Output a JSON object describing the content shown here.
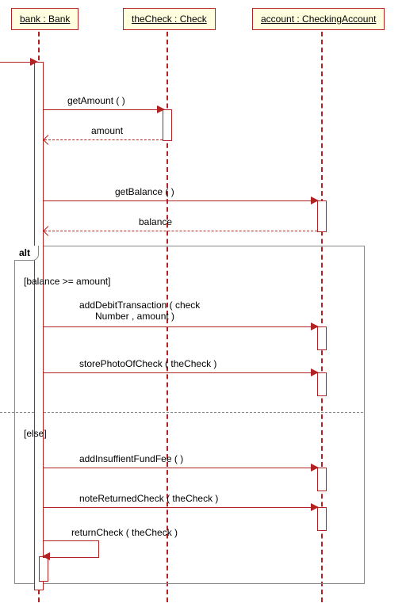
{
  "participants": {
    "bank": "bank : Bank",
    "check": "theCheck : Check",
    "account": "account : CheckingAccount"
  },
  "messages": {
    "getAmount": "getAmount ( )",
    "amount": "amount",
    "getBalance": "getBalance ( )",
    "balance": "balance",
    "addDebit": "addDebitTransaction ( check",
    "addDebit2": "Number , amount )",
    "storePhoto": "storePhotoOfCheck ( theCheck )",
    "addFee": "addInsuffientFundFee ( )",
    "noteReturned": "noteReturnedCheck ( theCheck )",
    "returnCheck": "returnCheck ( theCheck )"
  },
  "frame": {
    "operator": "alt",
    "guard1": "[balance >= amount]",
    "guard2": "[else]"
  },
  "chart_data": {
    "type": "sequence_diagram",
    "participants": [
      {
        "name": "bank",
        "class": "Bank"
      },
      {
        "name": "theCheck",
        "class": "Check"
      },
      {
        "name": "account",
        "class": "CheckingAccount"
      }
    ],
    "interactions": [
      {
        "from": "bank",
        "to": "theCheck",
        "message": "getAmount()",
        "type": "sync"
      },
      {
        "from": "theCheck",
        "to": "bank",
        "message": "amount",
        "type": "return"
      },
      {
        "from": "bank",
        "to": "account",
        "message": "getBalance()",
        "type": "sync"
      },
      {
        "from": "account",
        "to": "bank",
        "message": "balance",
        "type": "return"
      },
      {
        "type": "alt",
        "regions": [
          {
            "guard": "balance >= amount",
            "messages": [
              {
                "from": "bank",
                "to": "account",
                "message": "addDebitTransaction(checkNumber, amount)",
                "type": "sync"
              },
              {
                "from": "bank",
                "to": "account",
                "message": "storePhotoOfCheck(theCheck)",
                "type": "sync"
              }
            ]
          },
          {
            "guard": "else",
            "messages": [
              {
                "from": "bank",
                "to": "account",
                "message": "addInsuffientFundFee()",
                "type": "sync"
              },
              {
                "from": "bank",
                "to": "account",
                "message": "noteReturnedCheck(theCheck)",
                "type": "sync"
              },
              {
                "from": "bank",
                "to": "bank",
                "message": "returnCheck(theCheck)",
                "type": "self"
              }
            ]
          }
        ]
      }
    ]
  }
}
